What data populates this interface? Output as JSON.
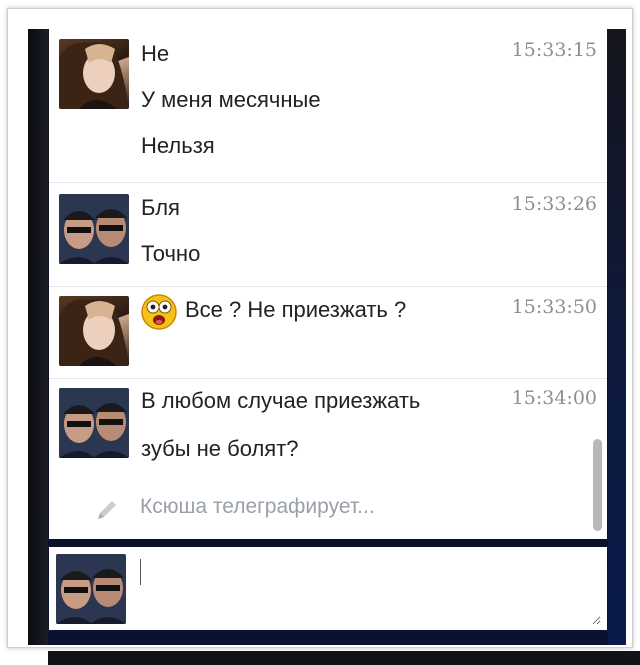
{
  "messages": [
    {
      "sender": "girl",
      "time": "15:33:15",
      "lines": [
        "Не",
        "У меня месячные",
        "Нельзя"
      ]
    },
    {
      "sender": "guys",
      "time": "15:33:26",
      "lines": [
        "Бля",
        "Точно"
      ]
    },
    {
      "sender": "girl",
      "time": "15:33:50",
      "emoji": "shocked-smiley",
      "lines": [
        "Все ? Не приезжать ?"
      ]
    },
    {
      "sender": "guys",
      "time": "15:34:00",
      "lines": [
        "В любом случае приезжать",
        "зубы не болят?"
      ]
    }
  ],
  "typing_indicator": "Ксюша телеграфирует...",
  "composer": {
    "value": ""
  },
  "colors": {
    "text": "#222222",
    "time": "#8a8f98",
    "typing": "#9aa0a8",
    "divider": "#e5e8ee"
  }
}
